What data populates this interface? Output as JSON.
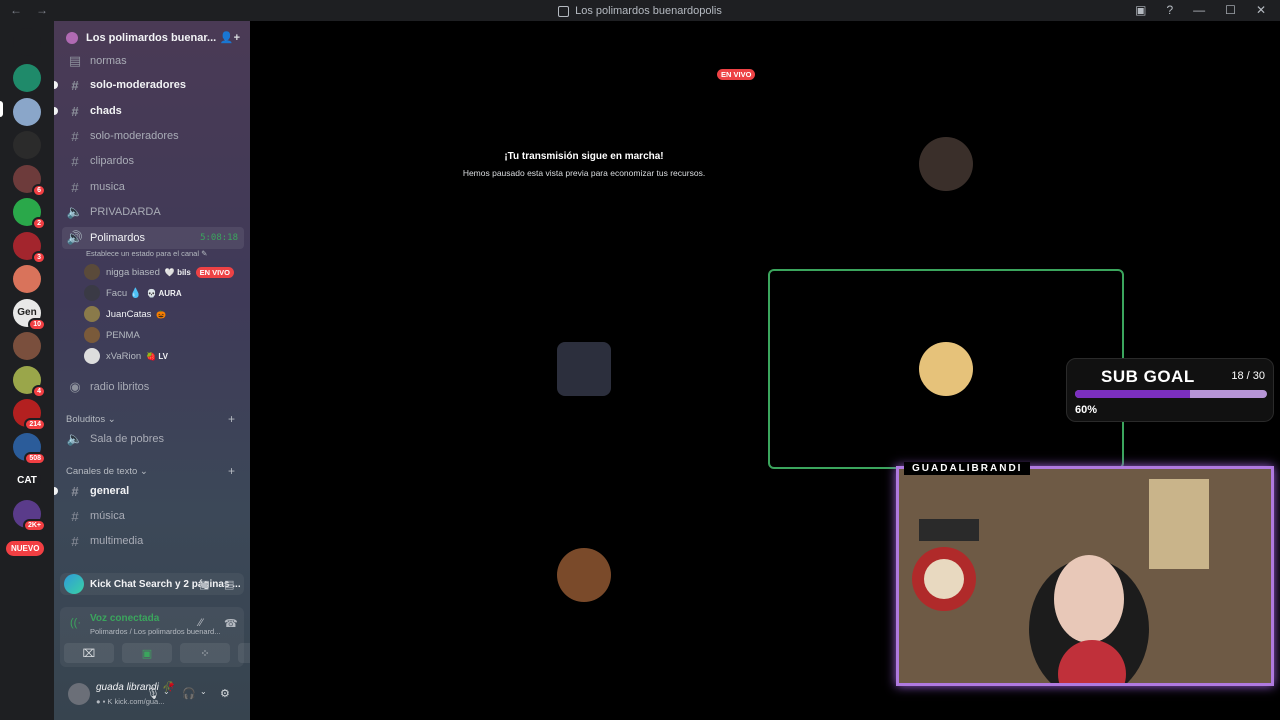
{
  "window": {
    "title": "Los polimardos buenardopolis",
    "back": "←",
    "forward": "→",
    "buttons": [
      "▣",
      "?",
      "—",
      "☐",
      "✕"
    ]
  },
  "servers": [
    {
      "icon": "discord-home-icon",
      "label": "",
      "color": "#1e1f22",
      "badge": ""
    },
    {
      "icon": "server-globe-icon",
      "label": "",
      "color": "#1f8a6a",
      "badge": ""
    },
    {
      "icon": "server-collage-icon",
      "label": "",
      "color": "#8aa6c9",
      "badge": ""
    },
    {
      "icon": "server-dark-icon",
      "label": "",
      "color": "#2b2b2b",
      "badge": ""
    },
    {
      "icon": "server-avatar-icon",
      "label": "",
      "color": "#6d3b3b",
      "badge": "6"
    },
    {
      "icon": "server-green-icon",
      "label": "",
      "color": "#2aa84a",
      "badge": "2"
    },
    {
      "icon": "server-red-icon",
      "label": "",
      "color": "#a3252d",
      "badge": "3"
    },
    {
      "icon": "server-cartoon-icon",
      "label": "",
      "color": "#d9735b",
      "badge": ""
    },
    {
      "icon": "server-text-icon",
      "label": "Gen",
      "color": "#e8e8e8",
      "badge": "10"
    },
    {
      "icon": "server-photo-icon",
      "label": "",
      "color": "#7a4f3d",
      "badge": ""
    },
    {
      "icon": "server-landscape-icon",
      "label": "",
      "color": "#9aa64a",
      "badge": "4"
    },
    {
      "icon": "server-red-logo-icon",
      "label": "",
      "color": "#b32020",
      "badge": "214"
    },
    {
      "icon": "server-blue-icon",
      "label": "",
      "color": "#2b5c9a",
      "badge": "508"
    },
    {
      "icon": "server-cat-icon",
      "label": "CAT",
      "color": "#1e1f22",
      "badge": ""
    },
    {
      "icon": "server-purple-icon",
      "label": "",
      "color": "#5a3b8a",
      "badge": "2K+"
    }
  ],
  "nuevo": "NUEVO",
  "guild": {
    "name": "Los polimardos buenar...",
    "chevron": "⌄",
    "invite": "👤+"
  },
  "channels": {
    "normas": "normas",
    "solo_mod_1": "solo-moderadores",
    "chads": "chads",
    "solo_mod_2": "solo-moderadores",
    "clipardos": "clipardos",
    "musica": "musica",
    "privadarda": "PRIVADARDA",
    "polimardos": "Polimardos",
    "polimardos_timer": "5:08:18",
    "polimardos_status": "Establece un estado para el canal ✎",
    "radio": "radio libritos",
    "cat_boludits": "Boluditos ⌄",
    "sala": "Sala de pobres",
    "cat_texto": "Canales de texto ⌄",
    "general": "general",
    "musica2": "música",
    "multimedia": "multimedia",
    "plus": "+"
  },
  "voice_users": [
    {
      "name": "nigga biased",
      "tag": "🤍 bils",
      "live": "EN VIVO",
      "color": "#5a4a3a"
    },
    {
      "name": "Facu 💧",
      "tag": "💀 AURA",
      "live": "",
      "color": "#3a3a45"
    },
    {
      "name": "JuanCatas",
      "tag": "🎃",
      "live": "",
      "color": "#8a7a4a"
    },
    {
      "name": "PENMA",
      "tag": "",
      "live": "",
      "color": "#7a5a3a"
    },
    {
      "name": "xVaRion",
      "tag": "🍓 LV",
      "live": "",
      "color": "#ddd"
    }
  ],
  "activity": {
    "text": "Kick Chat Search y 2 páginas ...",
    "icons": [
      "▣",
      "▤"
    ]
  },
  "voice": {
    "title": "Voz conectada",
    "subtitle": "Polimardos / Los polimardos buenard...",
    "signal": "((·",
    "icons": [
      "⁄⁄",
      "☎"
    ],
    "buttons": [
      "⌧",
      "▣",
      "⁘",
      "✦"
    ]
  },
  "user": {
    "name": "guada librandi 🥀",
    "status": "● ▪ K kick.com/gua...",
    "icons": [
      "🎙",
      "⌄",
      "🎧",
      "⌄",
      "⚙"
    ]
  },
  "stage": {
    "live_badge": "EN VIVO",
    "paused_title": "¡Tu transmisión sigue en marcha!",
    "paused_text": "Hemos pausado esta vista previa para economizar tus recursos.",
    "tile_colors": [
      "#000000",
      "#1e1d1b",
      "#23252e",
      "#cfb683",
      "#3a3838",
      "#1e1e1e"
    ]
  },
  "overlay": {
    "goal_title": "SUB GOAL",
    "goal_count": "18 / 30",
    "goal_percent": "60%",
    "goal_fraction": 0.6,
    "cam_label": "GUADALIBRANDI"
  }
}
